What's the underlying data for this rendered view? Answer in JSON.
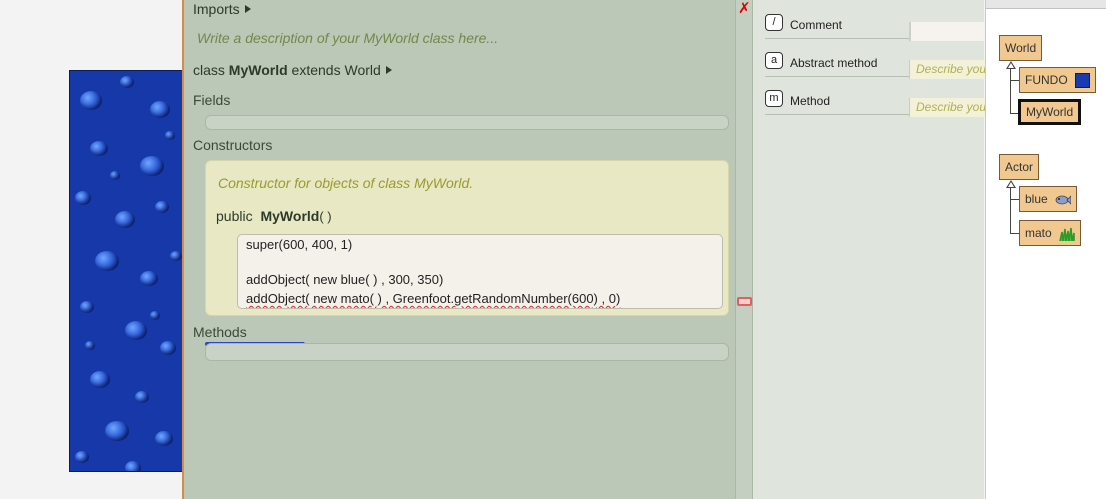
{
  "editor": {
    "imports_label": "Imports",
    "class_comment": "Write a description of your MyWorld class here...",
    "class_keyword": "class",
    "class_name": "MyWorld",
    "extends_keyword": "extends",
    "superclass": "World",
    "fields_label": "Fields",
    "constructors_label": "Constructors",
    "constructor": {
      "comment": "Constructor for objects of class MyWorld.",
      "access": "public",
      "name": "MyWorld",
      "parens": "( )",
      "code_lines": [
        "super(600, 400, 1)",
        "",
        "addObject( new blue( ) , 300, 350)",
        "addObject( new mato( ) , Greenfoot.getRandomNumber(600) , 0)"
      ]
    },
    "methods_label": "Methods",
    "close_symbol": "✗"
  },
  "catalogue": {
    "items": [
      {
        "key": "/",
        "label": "Comment",
        "preview": ""
      },
      {
        "key": "a",
        "label": "Abstract method",
        "preview": "Describe you"
      },
      {
        "key": "m",
        "label": "Method",
        "preview": "Describe you"
      }
    ]
  },
  "class_diagram": {
    "world_root": "World",
    "world_subclasses": [
      "FUNDO",
      "MyWorld"
    ],
    "actor_root": "Actor",
    "actor_subclasses": [
      "blue",
      "mato"
    ],
    "selected": "MyWorld"
  },
  "colors": {
    "editor_bg": "#bbc7b7",
    "constructor_bg": "#e8e8c4",
    "class_box": "#f0c890",
    "error_red": "#d00000",
    "world_blue": "#1638a8"
  }
}
